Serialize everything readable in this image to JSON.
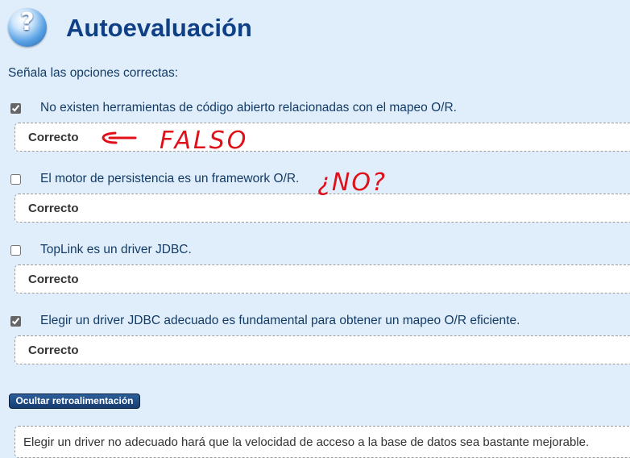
{
  "header": {
    "title": "Autoevaluación",
    "icon": "question-icon"
  },
  "instruction": "Señala las opciones correctas:",
  "questions": [
    {
      "text": "No existen herramientas de código abierto relacionadas con el mapeo O/R.",
      "checked": true,
      "feedback": "Correcto"
    },
    {
      "text": "El motor de persistencia es un framework O/R.",
      "checked": false,
      "feedback": "Correcto"
    },
    {
      "text": "TopLink es un driver JDBC.",
      "checked": false,
      "feedback": "Correcto"
    },
    {
      "text": "Elegir un driver JDBC adecuado es fundamental para obtener un mapeo O/R eficiente.",
      "checked": true,
      "feedback": "Correcto"
    }
  ],
  "toggle_button": {
    "label": "Ocultar retroalimentación"
  },
  "retroalimentacion": {
    "text": "Elegir un driver no adecuado hará que la velocidad de acceso a la base de datos sea bastante mejorable."
  },
  "handwriting": {
    "note_1": "FALSO",
    "note_2": "¿NO?",
    "color": "#e0101a"
  },
  "colors": {
    "background": "#dfeefa",
    "title": "#0f3f85",
    "text": "#143b66",
    "button": "#1f4d86"
  }
}
